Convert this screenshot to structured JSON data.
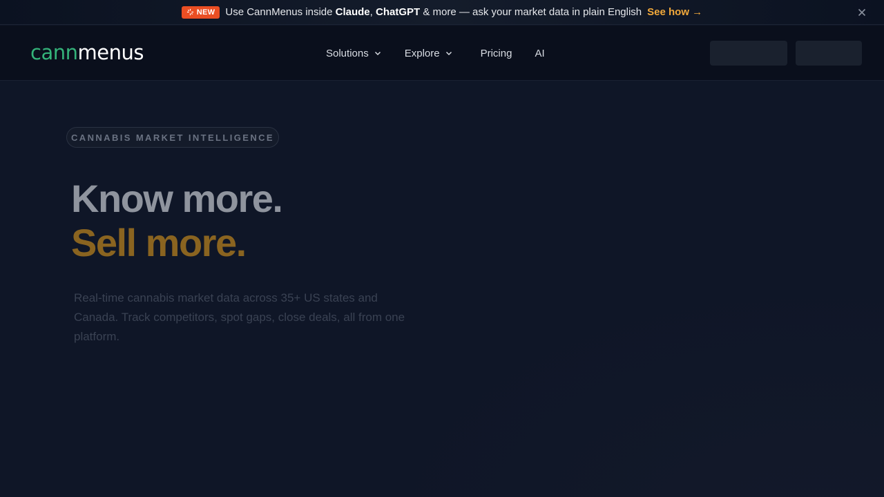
{
  "announcement": {
    "badge": "NEW",
    "text_prefix": "Use CannMenus inside ",
    "bold1": "Claude",
    "sep": ", ",
    "bold2": "ChatGPT",
    "text_suffix": " & more — ask your market data in plain English",
    "link": "See how →",
    "close_icon": "close-icon",
    "colors": {
      "badge": "#ea4e23",
      "link": "#f2a93b"
    }
  },
  "header": {
    "logo_part1": "cann",
    "logo_part2": "menus",
    "nav": [
      {
        "label": "Solutions",
        "icon": "chevron-down-icon"
      },
      {
        "label": "Explore",
        "icon": "chevron-down-icon"
      },
      {
        "label": "Pricing"
      },
      {
        "label": "AI"
      }
    ],
    "brand_color": "#34b37a"
  },
  "hero": {
    "eyebrow": "CANNABIS MARKET INTELLIGENCE",
    "headline_line1": "Know more.",
    "headline_line2": "Sell more.",
    "subtext": "Real-time cannabis market data across 35+ US states and Canada. Track competitors, spot gaps, close deals, all from one platform.",
    "accent_color": "#8a6420"
  }
}
